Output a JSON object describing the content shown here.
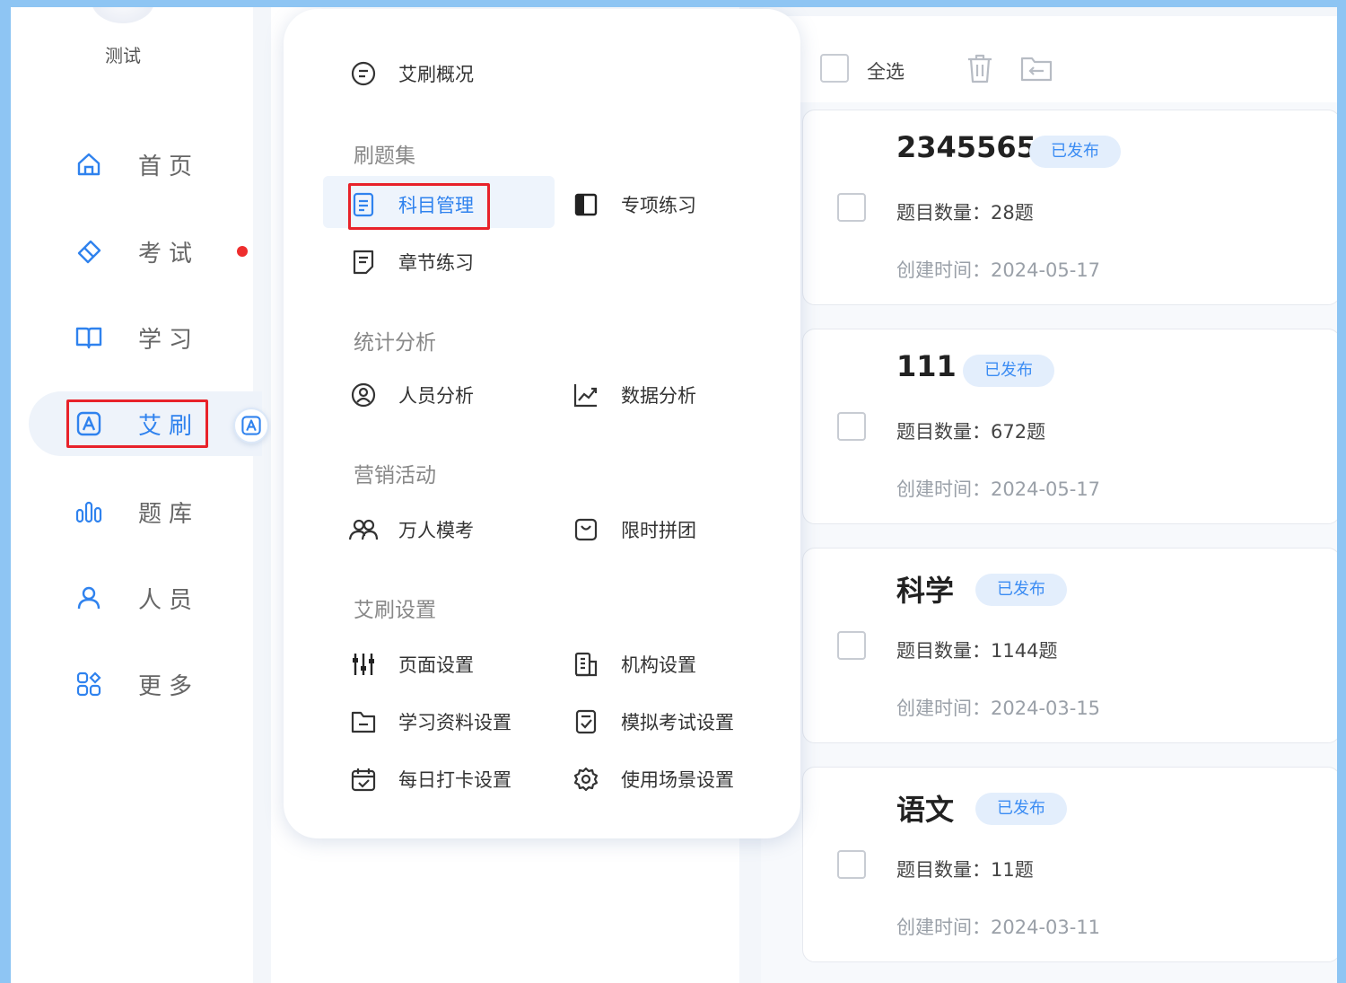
{
  "user": {
    "name": "测试"
  },
  "sidebar": {
    "items": [
      {
        "label": "首页",
        "icon": "home-icon"
      },
      {
        "label": "考试",
        "icon": "eraser-icon",
        "has_dot": true
      },
      {
        "label": "学习",
        "icon": "book-icon"
      },
      {
        "label": "艾刷",
        "icon": "a-square-icon",
        "active": true
      },
      {
        "label": "题库",
        "icon": "bars-icon"
      },
      {
        "label": "人员",
        "icon": "person-icon"
      },
      {
        "label": "更多",
        "icon": "grid-icon"
      }
    ]
  },
  "popup": {
    "overview": "艾刷概况",
    "sections": {
      "question_sets": "刷题集",
      "statistics": "统计分析",
      "marketing": "营销活动",
      "settings": "艾刷设置"
    },
    "items": {
      "subject_management": "科目管理",
      "special_practice": "专项练习",
      "chapter_practice": "章节练习",
      "personnel_analysis": "人员分析",
      "data_analysis": "数据分析",
      "mock_exam": "万人模考",
      "group_buy": "限时拼团",
      "page_settings": "页面设置",
      "org_settings": "机构设置",
      "study_material_settings": "学习资料设置",
      "mock_exam_settings": "模拟考试设置",
      "daily_checkin_settings": "每日打卡设置",
      "scenario_settings": "使用场景设置"
    }
  },
  "toolbar": {
    "select_all": "全选"
  },
  "cards": [
    {
      "title": "2345565",
      "status": "已发布",
      "count": "题目数量：28题",
      "created": "创建时间：2024-05-17"
    },
    {
      "title": "111",
      "status": "已发布",
      "count": "题目数量：672题",
      "created": "创建时间：2024-05-17"
    },
    {
      "title": "科学",
      "status": "已发布",
      "count": "题目数量：1144题",
      "created": "创建时间：2024-03-15"
    },
    {
      "title": "语文",
      "status": "已发布",
      "count": "题目数量：11题",
      "created": "创建时间：2024-03-11"
    }
  ],
  "colors": {
    "accent": "#2f82ee",
    "highlight": "#e8222a",
    "frame": "#8ec5f3"
  }
}
